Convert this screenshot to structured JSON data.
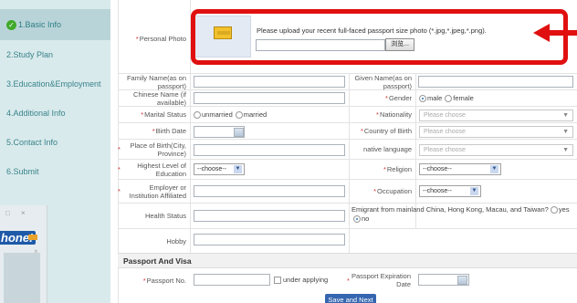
{
  "sidebar": {
    "items": [
      {
        "label": "1.Basic Info",
        "active": true
      },
      {
        "label": "2.Study Plan"
      },
      {
        "label": "3.Education&Employment"
      },
      {
        "label": "4.Additional Info"
      },
      {
        "label": "5.Contact Info"
      },
      {
        "label": "6.Submit"
      }
    ],
    "check_glyph": "✓"
  },
  "popup": {
    "controls": "□ ×",
    "logo": "hone!",
    "close": "×"
  },
  "photo": {
    "label": "Personal Photo",
    "instruction": "Please upload your recent full-faced passport size photo (*.jpg,*.jpeg,*.png).",
    "browse_label": "浏览...",
    "icon": "photo-placeholder-icon"
  },
  "fields": {
    "family_name": "Family Name(as on passport)",
    "given_name": "Given Name(as on passport)",
    "chinese_name": "Chinese Name (if available)",
    "gender": "Gender",
    "gender_male": "male",
    "gender_female": "female",
    "marital_status": "Marital Status",
    "marital_unmarried": "unmarried",
    "marital_married": "married",
    "nationality": "Nationality",
    "birth_date": "Birth Date",
    "country_of_birth": "Country of Birth",
    "place_of_birth": "Place of Birth(City, Province)",
    "native_language": "native language",
    "highest_level": "Highest Level of Education",
    "religion": "Religion",
    "employer": "Employer or Institution Affiliated",
    "occupation": "Occupation",
    "health_status": "Health Status",
    "emigrant_question": "Emigrant from mainland China, Hong Kong, Macau, and Taiwan?",
    "emigrant_yes": "yes",
    "emigrant_no": "no",
    "hobby": "Hobby"
  },
  "selects": {
    "please_choose": "Please choose",
    "choose_dash": "--choose--"
  },
  "passport": {
    "section_title": "Passport And Visa",
    "passport_no": "Passport No.",
    "under_applying": "under applying",
    "expiration_date": "Passport Expiration Date"
  },
  "actions": {
    "save_next": "Save and Next"
  },
  "colors": {
    "accent": "#3565b0",
    "sidebar": "#d9eaec",
    "required": "#d43131",
    "annotation": "#e01010"
  }
}
